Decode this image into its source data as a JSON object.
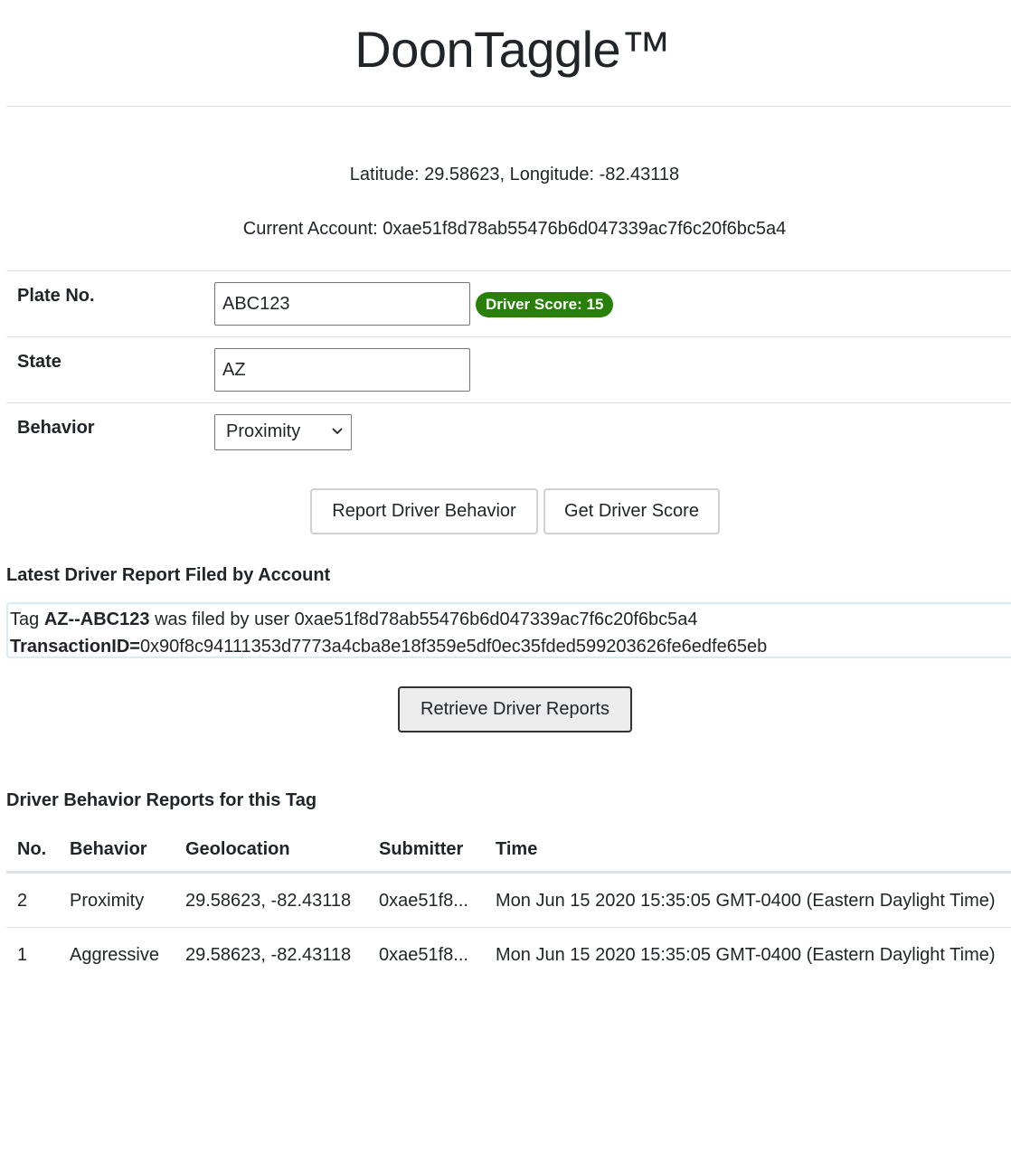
{
  "header": {
    "title": "DoonTaggle™"
  },
  "location": {
    "text": "Latitude: 29.58623, Longitude: -82.43118"
  },
  "account": {
    "text": "Current Account: 0xae51f8d78ab55476b6d047339ac7f6c20f6bc5a4"
  },
  "form": {
    "plate_label": "Plate No.",
    "plate_value": "ABC123",
    "driver_score_badge": "Driver Score: 15",
    "state_label": "State",
    "state_value": "AZ",
    "behavior_label": "Behavior",
    "behavior_selected": "Proximity"
  },
  "buttons": {
    "report": "Report Driver Behavior",
    "get_score": "Get Driver Score",
    "retrieve": "Retrieve Driver Reports"
  },
  "latest_report": {
    "heading": "Latest Driver Report Filed by Account",
    "tag_prefix": "Tag",
    "tag": "AZ--ABC123",
    "filed_by_text": "was filed by user 0xae51f8d78ab55476b6d047339ac7f6c20f6bc5a4",
    "tx_label": "TransactionID=",
    "tx_value": "0x90f8c94111353d7773a4cba8e18f359e5df0ec35fded599203626fe6edfe65eb"
  },
  "reports_table": {
    "heading": "Driver Behavior Reports for this Tag",
    "columns": {
      "no": "No.",
      "behavior": "Behavior",
      "geolocation": "Geolocation",
      "submitter": "Submitter",
      "time": "Time"
    },
    "rows": [
      {
        "no": "2",
        "behavior": "Proximity",
        "geolocation": "29.58623, -82.43118",
        "submitter": "0xae51f8...",
        "time": "Mon Jun 15 2020 15:35:05 GMT-0400 (Eastern Daylight Time)"
      },
      {
        "no": "1",
        "behavior": "Aggressive",
        "geolocation": "29.58623, -82.43118",
        "submitter": "0xae51f8...",
        "time": "Mon Jun 15 2020 15:35:05 GMT-0400 (Eastern Daylight Time)"
      }
    ]
  },
  "colors": {
    "badge_green": "#28800a",
    "divider": "#dee2e6",
    "report_box_border": "#d4eef2"
  }
}
